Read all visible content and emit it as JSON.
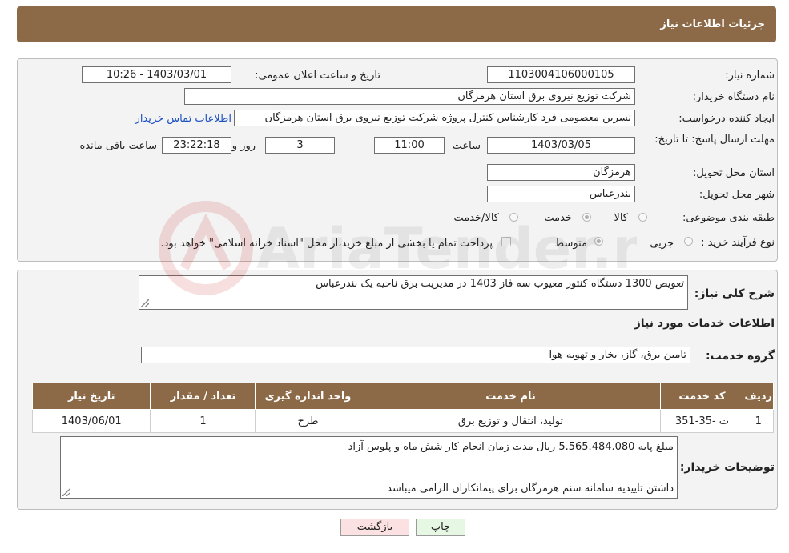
{
  "header": {
    "title": "جزئیات اطلاعات نیاز"
  },
  "info": {
    "need_number_label": "شماره نیاز:",
    "need_number": "1103004106000105",
    "announce_label": "تاریخ و ساعت اعلان عمومی:",
    "announce_value": "1403/03/01 - 10:26",
    "buyer_org_label": "نام دستگاه خریدار:",
    "buyer_org": "شرکت توزیع نیروی برق استان هرمزگان",
    "creator_label": "ایجاد کننده درخواست:",
    "creator": "نسرین معصومی فرد کارشناس کنترل پروژه شرکت توزیع نیروی برق استان هرمزگان",
    "contact_link": "اطلاعات تماس خریدار",
    "deadline_label": "مهلت ارسال پاسخ: تا تاریخ:",
    "deadline_date": "1403/03/05",
    "time_label": "ساعت",
    "deadline_time": "11:00",
    "days_value": "3",
    "days_label": "روز و",
    "remaining_time": "23:22:18",
    "remaining_label": "ساعت باقی مانده",
    "province_label": "استان محل تحویل:",
    "province": "هرمزگان",
    "city_label": "شهر محل تحویل:",
    "city": "بندرعباس",
    "category_label": "طبقه بندی موضوعی:",
    "category_options": [
      "کالا",
      "خدمت",
      "کالا/خدمت"
    ],
    "category_selected": "خدمت",
    "process_label": "نوع فرآیند خرید :",
    "process_options": [
      "جزیی",
      "متوسط"
    ],
    "process_selected": "متوسط",
    "payment_note": "پرداخت تمام یا بخشی از مبلغ خرید،از محل \"اسناد خزانه اسلامی\" خواهد بود."
  },
  "summary": {
    "label": "شرح کلی نیاز:",
    "value": "تعویض 1300 دستگاه کنتور معیوب سه فاز 1403 در مدیریت برق ناحیه یک بندرعباس"
  },
  "services": {
    "section_title": "اطلاعات خدمات مورد نیاز",
    "group_label": "گروه خدمت:",
    "group_value": "تامین برق، گاز، بخار و تهویه هوا",
    "columns": [
      "ردیف",
      "کد خدمت",
      "نام خدمت",
      "واحد اندازه گیری",
      "تعداد / مقدار",
      "تاریخ نیاز"
    ],
    "rows": [
      [
        "1",
        "ت -35-351",
        "تولید، انتقال و توزیع برق",
        "طرح",
        "1",
        "1403/06/01"
      ]
    ]
  },
  "buyer_notes": {
    "label": "توضیحات خریدار:",
    "line1": "مبلغ پایه 5.565.484.080 ریال مدت زمان انجام کار شش ماه و پلوس آزاد",
    "line2": "داشتن تاییدیه سامانه سنم هرمزگان برای پیمانکاران الزامی میباشد"
  },
  "buttons": {
    "print": "چاپ",
    "back": "بازگشت"
  },
  "watermark": {
    "text": "AriaTender.neT"
  },
  "colors": {
    "header_bg": "#8d6a47",
    "print_btn": "#e6f7e3",
    "back_btn": "#fbe1e1",
    "link": "#1a4fc2"
  }
}
